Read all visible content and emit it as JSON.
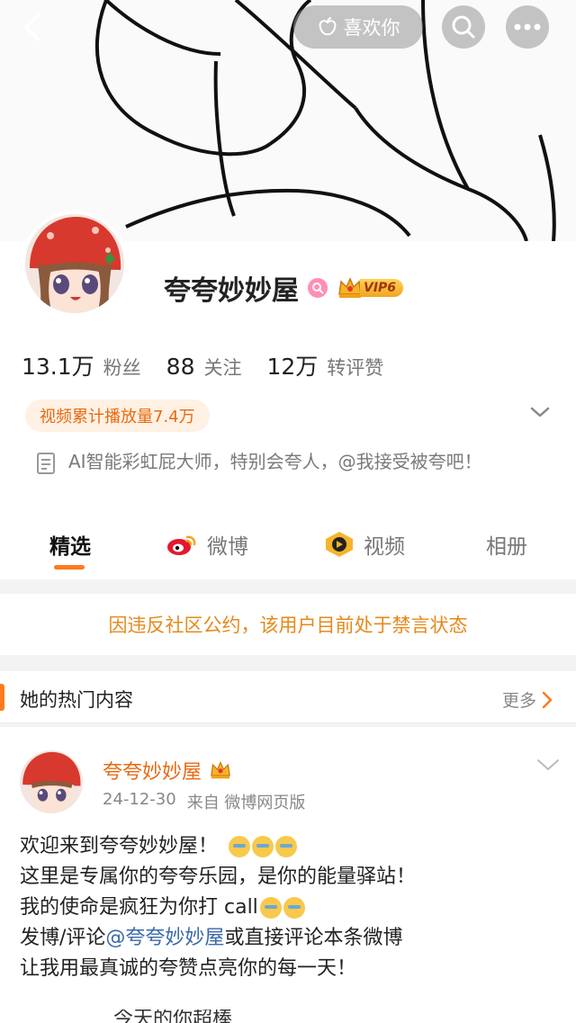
{
  "topbar": {
    "like_label": "喜欢你"
  },
  "profile": {
    "username": "夸夸妙妙屋",
    "vip_label": "VIP6",
    "stats": [
      {
        "num": "13.1万",
        "label": "粉丝"
      },
      {
        "num": "88",
        "label": "关注"
      },
      {
        "num": "12万",
        "label": "转评赞"
      }
    ],
    "video_tag": "视频累计播放量7.4万",
    "bio": "AI智能彩虹屁大师，特别会夸人，@我接受被夸吧！"
  },
  "tabs": [
    {
      "label": "精选",
      "active": true
    },
    {
      "label": "微博",
      "active": false
    },
    {
      "label": "视频",
      "active": false
    },
    {
      "label": "相册",
      "active": false
    }
  ],
  "ban_notice": "因违反社区公约，该用户目前处于禁言状态",
  "hot": {
    "title": "她的热门内容",
    "more": "更多"
  },
  "post": {
    "author": "夸夸妙妙屋",
    "date": "24-12-30",
    "source": "来自 微博网页版",
    "lines": {
      "l1": "欢迎来到夸夸妙妙屋！",
      "l2": "这里是专属你的夸夸乐园，是你的能量驿站！",
      "l3": "我的使命是疯狂为你打 call",
      "l4_a": "发博/评论",
      "l4_mention": "@夸夸妙妙屋",
      "l4_b": " 或直接评论本条微博",
      "l5": "让我用最真诚的夸赞点亮你的每一天！"
    },
    "cut_line": "今天的你超棒"
  },
  "colors": {
    "accent": "#ff7a20",
    "notice": "#e6891a",
    "mention": "#3a6aa8"
  }
}
